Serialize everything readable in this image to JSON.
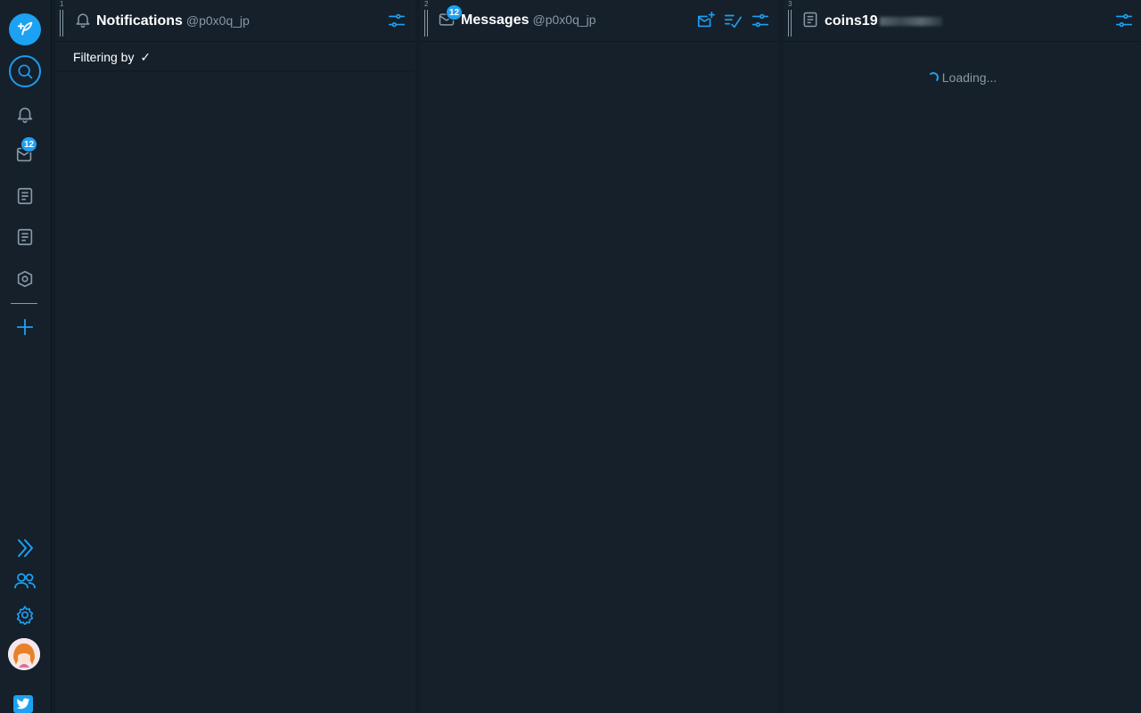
{
  "app": {
    "accent_color": "#1da1f2",
    "background_color": "#15202b"
  },
  "sidebar": {
    "items": [
      {
        "name": "compose",
        "icon": "feather-plus-icon"
      },
      {
        "name": "search",
        "icon": "search-icon"
      },
      {
        "name": "notifications",
        "icon": "bell-icon"
      },
      {
        "name": "messages",
        "icon": "messages-icon",
        "badge": "12"
      },
      {
        "name": "list-1",
        "icon": "list-icon"
      },
      {
        "name": "list-2",
        "icon": "list-icon"
      },
      {
        "name": "activity",
        "icon": "home-hexagon-icon"
      },
      {
        "name": "add-column",
        "icon": "plus-icon"
      }
    ],
    "bottom": [
      {
        "name": "expand",
        "icon": "double-chevron-right-icon"
      },
      {
        "name": "accounts",
        "icon": "people-icon"
      },
      {
        "name": "settings",
        "icon": "gear-icon"
      },
      {
        "name": "avatar",
        "icon": "avatar-image"
      },
      {
        "name": "twitter",
        "icon": "twitter-bird-icon"
      }
    ],
    "messages_badge": "12"
  },
  "columns": [
    {
      "number": "1",
      "title": "Notifications",
      "handle": "@p0x0q_jp",
      "icon": "bell-icon",
      "filter_label": "Filtering by",
      "filter_check": "✓"
    },
    {
      "number": "2",
      "title": "Messages",
      "handle": "@p0x0q_jp",
      "icon": "envelope-icon",
      "badge": "12"
    },
    {
      "number": "3",
      "title": "coins19",
      "icon": "list-icon",
      "loading_text": "Loading..."
    }
  ]
}
